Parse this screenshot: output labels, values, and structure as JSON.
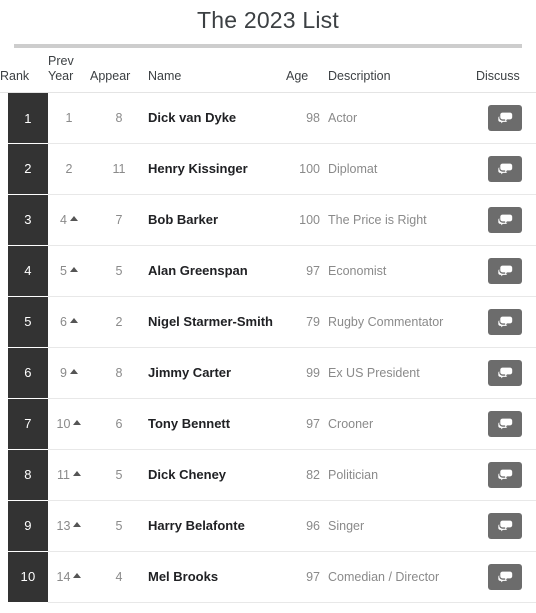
{
  "header": {
    "title": "The 2023 List"
  },
  "table": {
    "columns": [
      {
        "key": "rank",
        "label": "Rank"
      },
      {
        "key": "prev",
        "label": "Prev Year"
      },
      {
        "key": "appear",
        "label": "Appear"
      },
      {
        "key": "name",
        "label": "Name"
      },
      {
        "key": "age",
        "label": "Age"
      },
      {
        "key": "desc",
        "label": "Description"
      },
      {
        "key": "discuss",
        "label": "Discuss"
      }
    ],
    "discuss_icon": "speech-bubble-icon",
    "rows": [
      {
        "rank": "1",
        "prev": "1",
        "prev_up": false,
        "appear": "8",
        "name": "Dick van Dyke",
        "age": "98",
        "desc": "Actor"
      },
      {
        "rank": "2",
        "prev": "2",
        "prev_up": false,
        "appear": "11",
        "name": "Henry Kissinger",
        "age": "100",
        "desc": "Diplomat"
      },
      {
        "rank": "3",
        "prev": "4",
        "prev_up": true,
        "appear": "7",
        "name": "Bob Barker",
        "age": "100",
        "desc": "The Price is Right"
      },
      {
        "rank": "4",
        "prev": "5",
        "prev_up": true,
        "appear": "5",
        "name": "Alan Greenspan",
        "age": "97",
        "desc": "Economist"
      },
      {
        "rank": "5",
        "prev": "6",
        "prev_up": true,
        "appear": "2",
        "name": "Nigel Starmer-Smith",
        "age": "79",
        "desc": "Rugby Commentator"
      },
      {
        "rank": "6",
        "prev": "9",
        "prev_up": true,
        "appear": "8",
        "name": "Jimmy Carter",
        "age": "99",
        "desc": "Ex US President"
      },
      {
        "rank": "7",
        "prev": "10",
        "prev_up": true,
        "appear": "6",
        "name": "Tony Bennett",
        "age": "97",
        "desc": "Crooner"
      },
      {
        "rank": "8",
        "prev": "11",
        "prev_up": true,
        "appear": "5",
        "name": "Dick Cheney",
        "age": "82",
        "desc": "Politician"
      },
      {
        "rank": "9",
        "prev": "13",
        "prev_up": true,
        "appear": "5",
        "name": "Harry Belafonte",
        "age": "96",
        "desc": "Singer"
      },
      {
        "rank": "10",
        "prev": "14",
        "prev_up": true,
        "appear": "4",
        "name": "Mel Brooks",
        "age": "97",
        "desc": "Comedian / Director"
      }
    ]
  },
  "colors": {
    "rank_chip_bg": "#333333",
    "discuss_button_bg": "#6c6c6c",
    "title_text": "#3c4043",
    "muted_text": "#8a8a8a",
    "rule": "#cdcdcd"
  }
}
